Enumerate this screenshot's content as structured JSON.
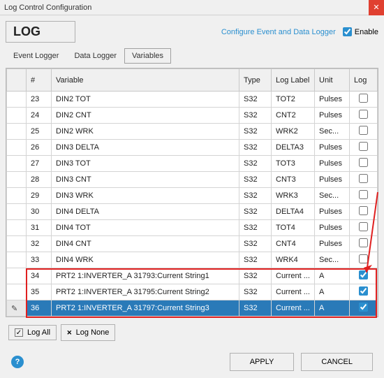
{
  "window": {
    "title": "Log Control Configuration"
  },
  "header": {
    "log_label": "LOG",
    "config_link": "Configure Event and Data Logger",
    "enable_label": "Enable",
    "enable_checked": true
  },
  "tabs": {
    "event": "Event Logger",
    "data": "Data Logger",
    "variables": "Variables",
    "active": "variables"
  },
  "columns": {
    "num": "#",
    "variable": "Variable",
    "type": "Type",
    "label": "Log Label",
    "unit": "Unit",
    "log": "Log"
  },
  "rows": [
    {
      "n": "23",
      "var": "DIN2 TOT",
      "type": "S32",
      "label": "TOT2",
      "unit": "Pulses",
      "log": false
    },
    {
      "n": "24",
      "var": "DIN2 CNT",
      "type": "S32",
      "label": "CNT2",
      "unit": "Pulses",
      "log": false
    },
    {
      "n": "25",
      "var": "DIN2 WRK",
      "type": "S32",
      "label": "WRK2",
      "unit": "Sec...",
      "log": false
    },
    {
      "n": "26",
      "var": "DIN3 DELTA",
      "type": "S32",
      "label": "DELTA3",
      "unit": "Pulses",
      "log": false
    },
    {
      "n": "27",
      "var": "DIN3 TOT",
      "type": "S32",
      "label": "TOT3",
      "unit": "Pulses",
      "log": false
    },
    {
      "n": "28",
      "var": "DIN3 CNT",
      "type": "S32",
      "label": "CNT3",
      "unit": "Pulses",
      "log": false
    },
    {
      "n": "29",
      "var": "DIN3 WRK",
      "type": "S32",
      "label": "WRK3",
      "unit": "Sec...",
      "log": false
    },
    {
      "n": "30",
      "var": "DIN4 DELTA",
      "type": "S32",
      "label": "DELTA4",
      "unit": "Pulses",
      "log": false
    },
    {
      "n": "31",
      "var": "DIN4 TOT",
      "type": "S32",
      "label": "TOT4",
      "unit": "Pulses",
      "log": false
    },
    {
      "n": "32",
      "var": "DIN4 CNT",
      "type": "S32",
      "label": "CNT4",
      "unit": "Pulses",
      "log": false
    },
    {
      "n": "33",
      "var": "DIN4 WRK",
      "type": "S32",
      "label": "WRK4",
      "unit": "Sec...",
      "log": false
    },
    {
      "n": "34",
      "var": "PRT2 1:INVERTER_A 31793:Current String1",
      "type": "S32",
      "label": "Current ...",
      "unit": "A",
      "log": true
    },
    {
      "n": "35",
      "var": "PRT2 1:INVERTER_A 31795:Current String2",
      "type": "S32",
      "label": "Current ...",
      "unit": "A",
      "log": true
    },
    {
      "n": "36",
      "var": "PRT2 1:INVERTER_A 31797:Current String3",
      "type": "S32",
      "label": "Current ...",
      "unit": "A",
      "log": true,
      "selected": true
    }
  ],
  "footer": {
    "log_all": "Log All",
    "log_none": "Log None",
    "apply": "APPLY",
    "cancel": "CANCEL"
  },
  "annotation": {
    "highlight_rows_from": 11,
    "highlight_rows_to": 13
  }
}
